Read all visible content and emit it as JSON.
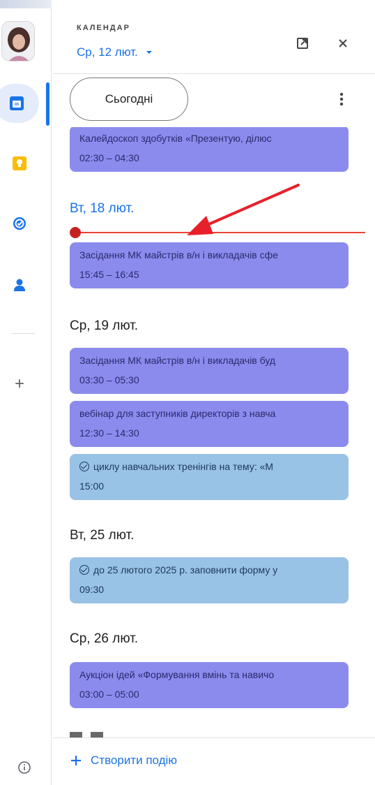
{
  "rail": {
    "items": [
      {
        "icon": "calendar-icon",
        "active": true,
        "color": "#1a73e8"
      },
      {
        "icon": "keep-icon",
        "active": false,
        "color": "#fbbc04"
      },
      {
        "icon": "tasks-icon",
        "active": false,
        "color": "#1a73e8"
      },
      {
        "icon": "contacts-icon",
        "active": false,
        "color": "#1a73e8"
      }
    ],
    "add_label": "+"
  },
  "header": {
    "kicker": "КАЛЕНДАР",
    "date": "Ср, 12 лют."
  },
  "toolbar": {
    "today_label": "Сьогодні"
  },
  "agenda": {
    "partial_event": {
      "title": "Калейдоскоп здобутків «Презентую, ділюс",
      "time": "02:30 – 04:30",
      "color": "purple"
    },
    "days": [
      {
        "heading": "Вт, 18 лют.",
        "today": true,
        "events": [
          {
            "title": "Засідання МК майстрів в/н і викладачів сфе",
            "time": "15:45 – 16:45",
            "color": "purple",
            "task": false
          }
        ]
      },
      {
        "heading": "Ср, 19 лют.",
        "today": false,
        "events": [
          {
            "title": "Засідання МК майстрів в/н і викладачів буд",
            "time": "03:30 – 05:30",
            "color": "purple",
            "task": false
          },
          {
            "title": "вебінар для заступників директорів з навча",
            "time": "12:30 – 14:30",
            "color": "purple",
            "task": false
          },
          {
            "title": "циклу навчальних тренінгів на тему: «М",
            "time": "15:00",
            "color": "blue",
            "task": true
          }
        ]
      },
      {
        "heading": "Вт, 25 лют.",
        "today": false,
        "events": [
          {
            "title": "до 25 лютого 2025 р. заповнити форму у",
            "time": "09:30",
            "color": "blue",
            "task": true
          }
        ]
      },
      {
        "heading": "Ср, 26 лют.",
        "today": false,
        "events": [
          {
            "title": "Аукціон ідей «Формування вмінь та навичо",
            "time": "03:00 – 05:00",
            "color": "purple",
            "task": false
          }
        ]
      }
    ]
  },
  "footer": {
    "create_label": "Створити подію"
  },
  "colors": {
    "accent": "#1a73e8",
    "event_purple": "#8b8bee",
    "event_blue": "#98c2e6",
    "now_line": "#ea4335",
    "annotation_arrow": "#e8202a"
  }
}
